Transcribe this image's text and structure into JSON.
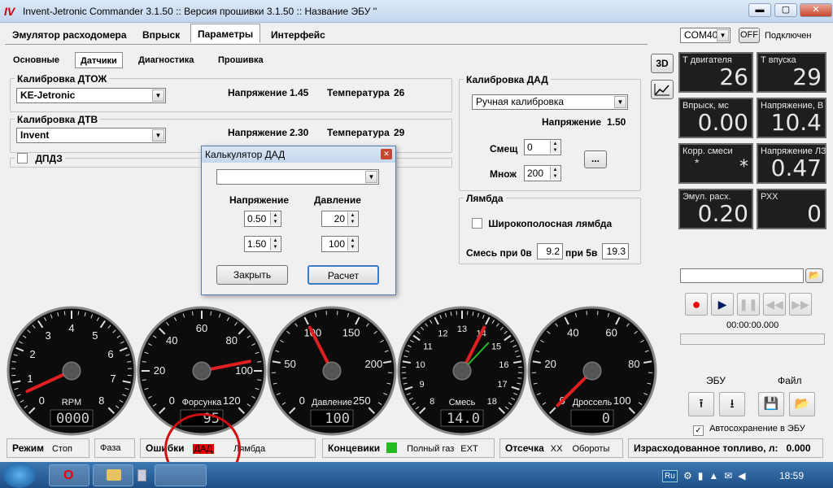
{
  "window": {
    "title": "Invent-Jetronic Commander 3.1.50 :: Версия прошивки 3.1.50 :: Название ЭБУ ''",
    "logo": "IV DET",
    "min": "▬",
    "max": "▢",
    "close": "✕"
  },
  "top_tabs": [
    "Эмулятор расходомера",
    "Впрыск",
    "Параметры",
    "Интерфейс"
  ],
  "com": {
    "port": "COM40",
    "off_label": "OFF",
    "status": "Подключен"
  },
  "sub_tabs": [
    "Основные",
    "Датчики",
    "Диагностика",
    "Прошивка"
  ],
  "dtozh": {
    "legend": "Калибровка ДТОЖ",
    "value": "KE-Jetronic",
    "volt_label": "Напряжение",
    "volt": "1.45",
    "temp_label": "Температура",
    "temp": "26"
  },
  "dtv": {
    "legend": "Калибровка ДТВ",
    "value": "Invent",
    "volt_label": "Напряжение",
    "volt": "2.30",
    "temp_label": "Температура",
    "temp": "29"
  },
  "dpdz": {
    "label": "ДПДЗ"
  },
  "dad": {
    "legend": "Калибровка ДАД",
    "mode": "Ручная калибровка",
    "volt_label": "Напряжение",
    "volt": "1.50",
    "offset_label": "Смещ",
    "offset": "0",
    "mult_label": "Множ",
    "mult": "200",
    "dots": "..."
  },
  "lambda": {
    "legend": "Лямбда",
    "wide_label": "Широкополосная лямбда",
    "mix_label": "Смесь при 0в",
    "mix0": "9.2",
    "at5_label": "при 5в",
    "mix5": "19.3"
  },
  "calc": {
    "title": "Калькулятор ДАД",
    "combo": "",
    "col_volt": "Напряжение",
    "col_press": "Давление",
    "v1": "0.50",
    "p1": "20",
    "v2": "1.50",
    "p2": "100",
    "close_btn": "Закрыть",
    "calc_btn": "Расчет"
  },
  "side_icons": {
    "three_d": "3D",
    "chart": "chart-icon"
  },
  "panels": [
    {
      "label": "Т двигателя",
      "value": "26"
    },
    {
      "label": "Т впуска",
      "value": "29"
    },
    {
      "label": "Впрыск, мс",
      "value": "0.00"
    },
    {
      "label": "Напряжение, В",
      "value": "10.4"
    },
    {
      "label": "Корр. смеси",
      "value": "*",
      "value2": "*"
    },
    {
      "label": "Напряжение ЛЗ",
      "value": "0.47"
    },
    {
      "label": "Эмул. расх.",
      "value": "0.20"
    },
    {
      "label": "РХХ",
      "value": "0"
    }
  ],
  "player": {
    "time": "00:00:00.000"
  },
  "ecu_label": "ЭБУ",
  "file_label": "Файл",
  "autosave": "Автосохранение в ЭБУ",
  "gauges": [
    {
      "name": "RPM",
      "display": "0000",
      "ticks": [
        "0",
        "1",
        "2",
        "3",
        "4",
        "5",
        "6",
        "7",
        "8"
      ],
      "value": 0.6,
      "max": 8
    },
    {
      "name": "Форсунка",
      "display": "95",
      "ticks": [
        "0",
        "20",
        "40",
        "60",
        "80",
        "100",
        "120"
      ],
      "value": 95,
      "max": 120
    },
    {
      "name": "Давление",
      "display": "100",
      "ticks": [
        "0",
        "50",
        "100",
        "150",
        "200",
        "250"
      ],
      "value": 100,
      "max": 250
    },
    {
      "name": "Смесь",
      "display": "14.0",
      "ticks": [
        "8",
        "9",
        "10",
        "11",
        "12",
        "13",
        "14",
        "15",
        "16",
        "17",
        "18"
      ],
      "value": 14.0,
      "min": 8,
      "max": 18
    },
    {
      "name": "Дроссель",
      "display": "0",
      "ticks": [
        "0",
        "20",
        "40",
        "60",
        "80",
        "100"
      ],
      "value": 0,
      "max": 100
    }
  ],
  "status": {
    "mode_label": "Режим",
    "mode": "Стоп",
    "phase": "Фаза",
    "errors_label": "Ошибки",
    "error_dad": "ДАД",
    "error_lambda": "Лямбда",
    "limits_label": "Концевики",
    "full_throttle": "Полный газ",
    "ext": "EXT",
    "cutoff_label": "Отсечка",
    "xx": "XX",
    "revs": "Обороты",
    "fuel_label": "Израсходованное топливо, л:",
    "fuel": "0.000"
  },
  "tray": {
    "lang": "Ru",
    "time": "18:59"
  },
  "colors": {
    "error_red": "#e60000",
    "green": "#22bb22",
    "panel_bg": "#1e1e1e",
    "marker": "#cc1111"
  }
}
